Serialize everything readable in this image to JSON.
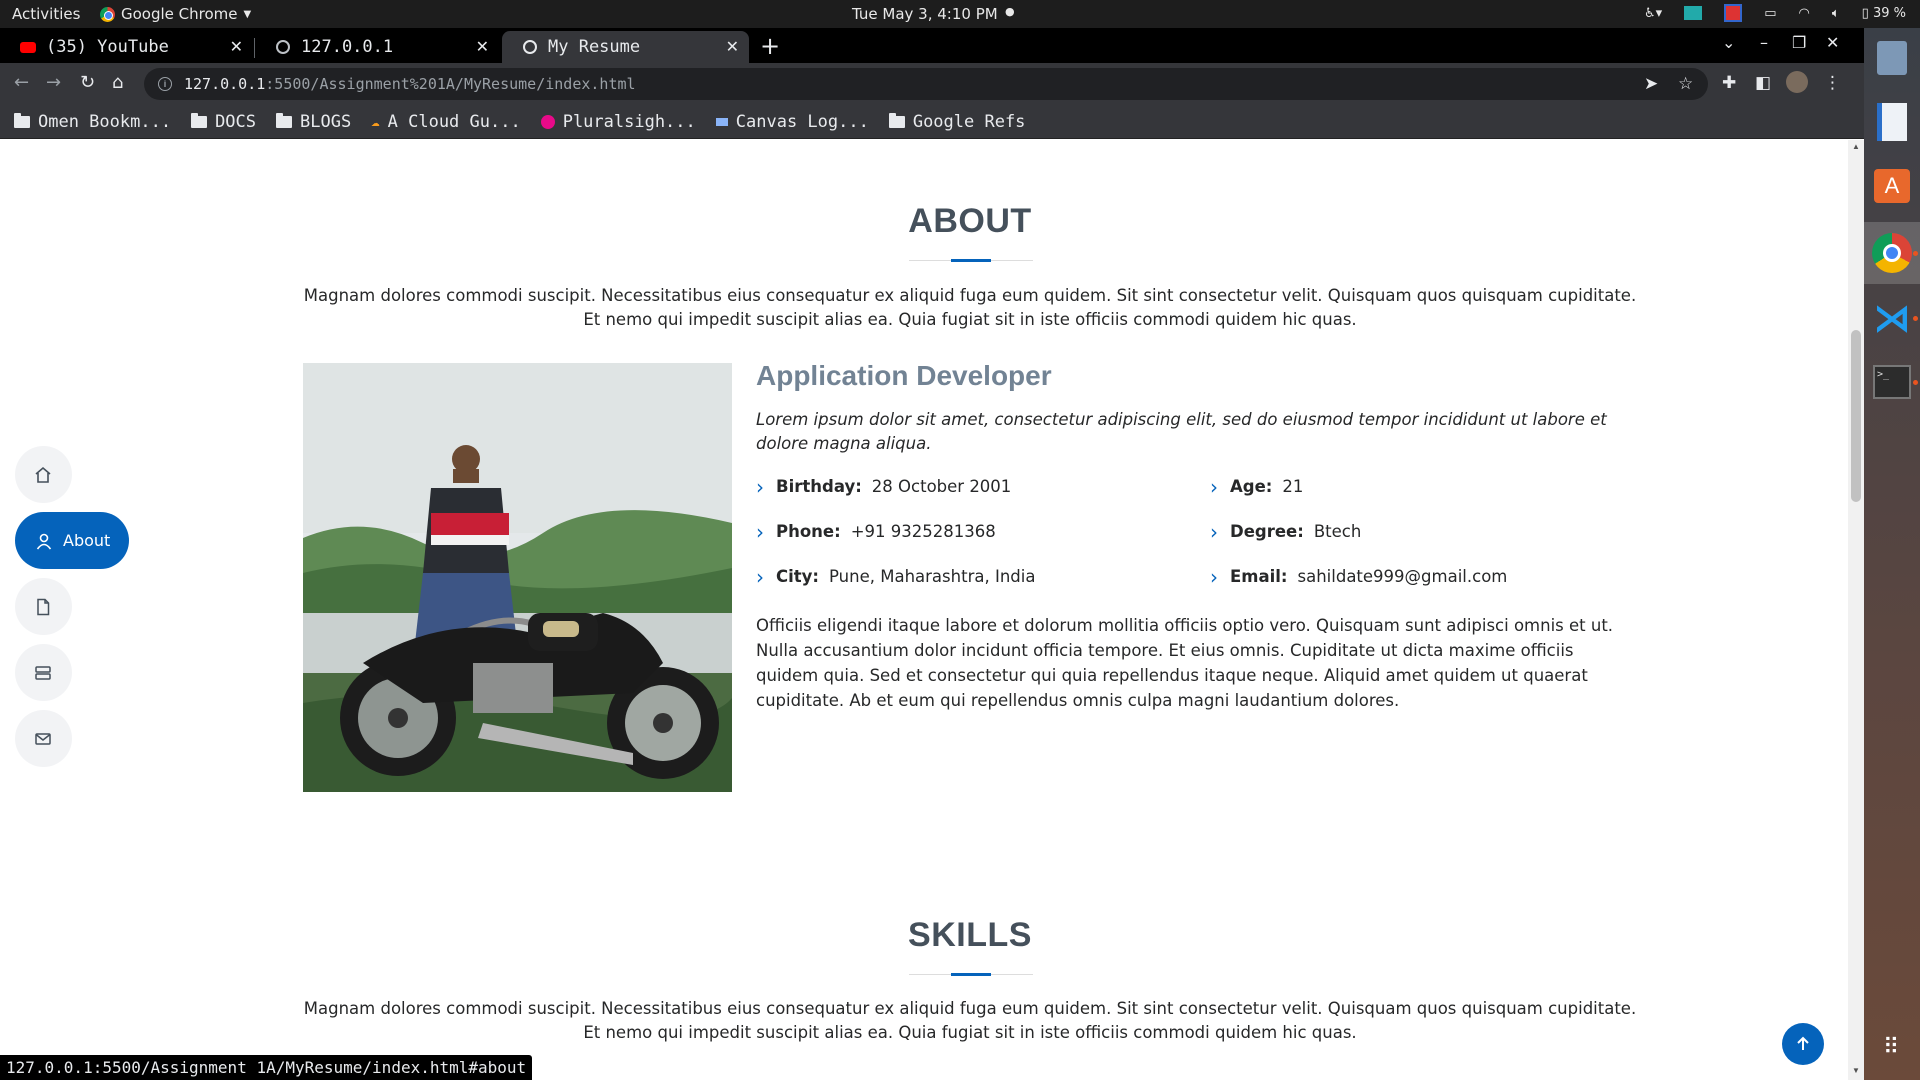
{
  "system_bar": {
    "activities": "Activities",
    "app_name": "Google Chrome",
    "clock": "Tue May  3,  4:10 PM",
    "battery": "39 %"
  },
  "tabs": [
    {
      "label": "(35) YouTube",
      "icon": "youtube-icon"
    },
    {
      "label": "127.0.0.1",
      "icon": "globe-icon"
    },
    {
      "label": "My Resume",
      "icon": "globe-icon",
      "active": true
    }
  ],
  "address_bar": {
    "host": "127.0.0.1",
    "path": ":5500/Assignment%201A/MyResume/index.html"
  },
  "bookmarks": [
    {
      "label": "Omen Bookm...",
      "icon": "folder-icon"
    },
    {
      "label": "DOCS",
      "icon": "folder-icon"
    },
    {
      "label": "BLOGS",
      "icon": "folder-icon"
    },
    {
      "label": "A Cloud Gu...",
      "icon": "acloudguru-icon"
    },
    {
      "label": "Pluralsigh...",
      "icon": "pluralsight-icon"
    },
    {
      "label": "Canvas Log...",
      "icon": "canvas-icon"
    },
    {
      "label": "Google Refs",
      "icon": "folder-icon"
    }
  ],
  "side_nav": {
    "items": [
      {
        "icon": "home-icon",
        "label": ""
      },
      {
        "icon": "person-icon",
        "label": "About",
        "active": true
      },
      {
        "icon": "file-icon",
        "label": ""
      },
      {
        "icon": "server-icon",
        "label": ""
      },
      {
        "icon": "envelope-icon",
        "label": ""
      }
    ]
  },
  "about": {
    "title": "ABOUT",
    "description": "Magnam dolores commodi suscipit. Necessitatibus eius consequatur ex aliquid fuga eum quidem. Sit sint consectetur velit. Quisquam quos quisquam cupiditate. Et nemo qui impedit suscipit alias ea. Quia fugiat sit in iste officiis commodi quidem hic quas.",
    "job_title": "Application Developer",
    "intro": "Lorem ipsum dolor sit amet, consectetur adipiscing elit, sed do eiusmod tempor incididunt ut labore et dolore magna aliqua.",
    "facts": [
      {
        "label": "Birthday:",
        "value": "28 October 2001"
      },
      {
        "label": "Age:",
        "value": "21"
      },
      {
        "label": "Phone:",
        "value": "+91 9325281368"
      },
      {
        "label": "Degree:",
        "value": "Btech"
      },
      {
        "label": "City:",
        "value": "Pune, Maharashtra, India"
      },
      {
        "label": "Email:",
        "value": "sahildate999@gmail.com"
      }
    ],
    "body": "Officiis eligendi itaque labore et dolorum mollitia officiis optio vero. Quisquam sunt adipisci omnis et ut. Nulla accusantium dolor incidunt officia tempore. Et eius omnis. Cupiditate ut dicta maxime officiis quidem quia. Sed et consectetur qui quia repellendus itaque neque. Aliquid amet quidem ut quaerat cupiditate. Ab et eum qui repellendus omnis culpa magni laudantium dolores."
  },
  "skills": {
    "title": "SKILLS",
    "description": "Magnam dolores commodi suscipit. Necessitatibus eius consequatur ex aliquid fuga eum quidem. Sit sint consectetur velit. Quisquam quos quisquam cupiditate. Et nemo qui impedit suscipit alias ea. Quia fugiat sit in iste officiis commodi quidem hic quas."
  },
  "status_url": "127.0.0.1:5500/Assignment 1A/MyResume/index.html#about",
  "colors": {
    "accent": "#0563bb",
    "heading": "#45505b",
    "job_title": "#728394"
  }
}
